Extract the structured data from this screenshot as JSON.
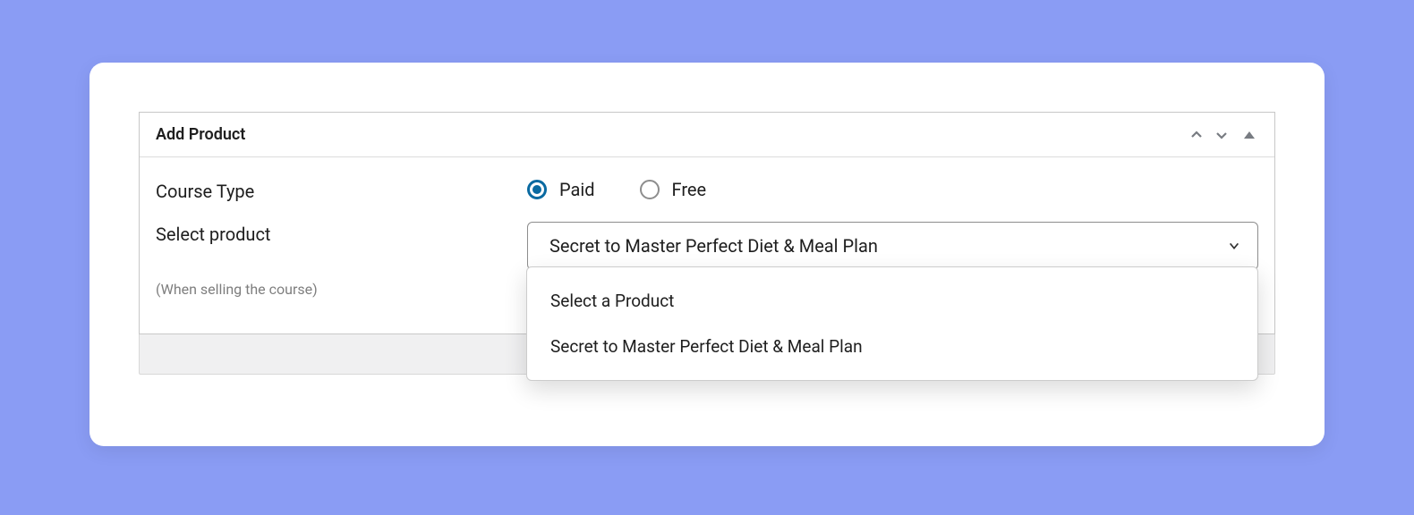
{
  "panel": {
    "title": "Add Product"
  },
  "fields": {
    "course_type": {
      "label": "Course Type",
      "options": {
        "paid": "Paid",
        "free": "Free"
      },
      "selected": "paid"
    },
    "select_product": {
      "label": "Select product",
      "hint": "(When selling the course)",
      "selected_value": "Secret to Master Perfect Diet & Meal Plan",
      "dropdown_options": [
        "Select a Product",
        "Secret to Master Perfect Diet & Meal Plan"
      ]
    }
  }
}
